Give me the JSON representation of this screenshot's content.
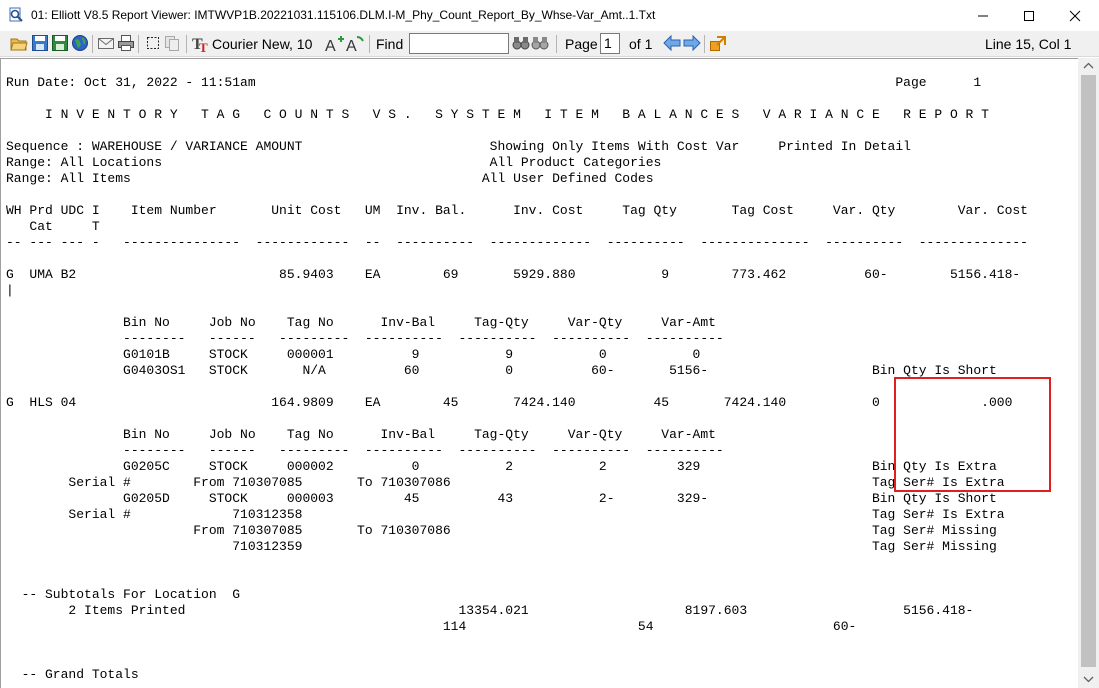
{
  "window": {
    "title": "01: Elliott V8.5 Report Viewer: IMTWVP1B.20221031.115106.DLM.I-M_Phy_Count_Report_By_Whse-Var_Amt..1.Txt"
  },
  "toolbar": {
    "font": "Courier New, 10",
    "find_label": "Find",
    "find_value": "",
    "page_label": "Page",
    "page_value": "1",
    "of_label": "of 1",
    "position": "Line 15, Col 1"
  },
  "report": {
    "lines": [
      "Run Date: Oct 31, 2022 - 11:51am                                                                                  Page      1",
      "",
      "     I N V E N T O R Y   T A G   C O U N T S   V S .   S Y S T E M   I T E M   B A L A N C E S   V A R I A N C E   R E P O R T",
      "",
      "Sequence : WAREHOUSE / VARIANCE AMOUNT                        Showing Only Items With Cost Var     Printed In Detail",
      "Range: All Locations                                          All Product Categories",
      "Range: All Items                                             All User Defined Codes",
      "",
      "WH Prd UDC I    Item Number       Unit Cost   UM  Inv. Bal.      Inv. Cost     Tag Qty       Tag Cost     Var. Qty        Var. Cost",
      "   Cat     T",
      "-- --- --- -   ---------------  ------------  --  ----------  -------------  ----------  --------------  ----------  --------------",
      "",
      "G  UMA B2                          85.9403    EA        69       5929.880           9        773.462          60-        5156.418-",
      "|",
      "",
      "               Bin No     Job No    Tag No      Inv-Bal     Tag-Qty     Var-Qty     Var-Amt",
      "               --------   ------   ---------  ----------  ----------  ----------  ----------",
      "               G0101B     STOCK     000001          9           9           0           0",
      "               G0403OS1   STOCK       N/A          60           0          60-       5156-                     Bin Qty Is Short",
      "",
      "G  HLS 04                         164.9809    EA        45       7424.140          45       7424.140           0             .000",
      "",
      "               Bin No     Job No    Tag No      Inv-Bal     Tag-Qty     Var-Qty     Var-Amt",
      "               --------   ------   ---------  ----------  ----------  ----------  ----------",
      "               G0205C     STOCK     000002          0           2           2         329                      Bin Qty Is Extra",
      "        Serial #        From 710307085       To 710307086                                                      Tag Ser# Is Extra",
      "               G0205D     STOCK     000003         45          43           2-        329-                     Bin Qty Is Short",
      "        Serial #             710312358                                                                         Tag Ser# Is Extra",
      "                        From 710307085       To 710307086                                                      Tag Ser# Missing",
      "                             710312359                                                                         Tag Ser# Missing",
      "",
      "",
      "  -- Subtotals For Location  G",
      "        2 Items Printed                                   13354.021                    8197.603                    5156.418-",
      "                                                        114                      54                       60-",
      "",
      "",
      "  -- Grand Totals"
    ]
  }
}
